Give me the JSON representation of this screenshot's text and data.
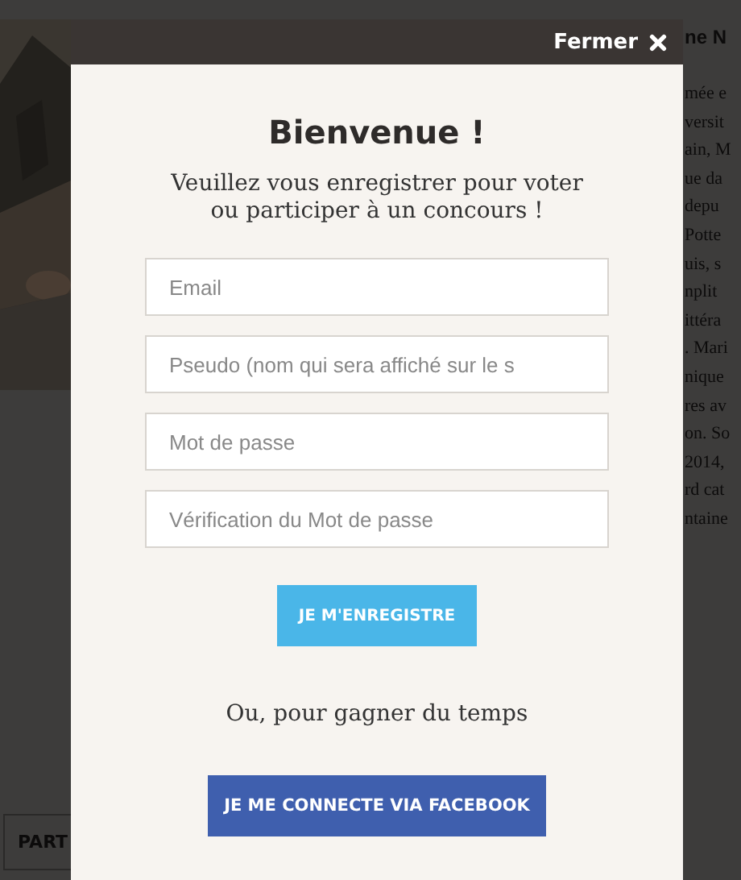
{
  "background": {
    "partial_button": "PART",
    "heading": "ne N",
    "text_lines": [
      "mée e",
      "versit",
      "ain, M",
      "ue da",
      "depu",
      "Potte",
      "uis, s",
      "nplit",
      "ittéra",
      ". Mari",
      "nique",
      "res av",
      "on. So",
      "2014,",
      "rd cat",
      "ntaine"
    ]
  },
  "modal": {
    "close_label": "Fermer",
    "title": "Bienvenue !",
    "subtitle": "Veuillez vous enregistrer pour voter ou participer à un concours !",
    "fields": [
      {
        "placeholder": "Email"
      },
      {
        "placeholder": "Pseudo (nom qui sera affiché sur le s"
      },
      {
        "placeholder": "Mot de passe"
      },
      {
        "placeholder": "Vérification du Mot de passe"
      }
    ],
    "register_button": "JE M'ENREGISTRE",
    "separator": "Ou, pour gagner du temps",
    "facebook_button": "JE ME CONNECTE VIA FACEBOOK"
  }
}
